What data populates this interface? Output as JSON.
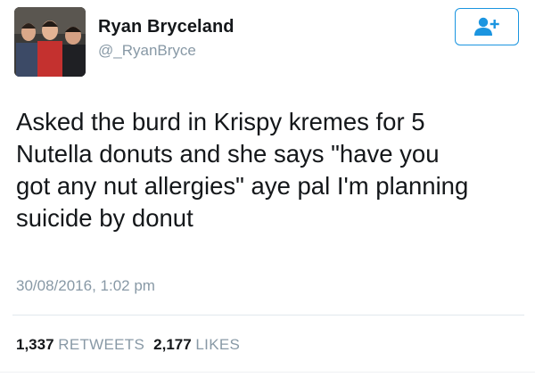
{
  "user": {
    "name": "Ryan Bryceland",
    "handle": "@_RyanBryce"
  },
  "tweet": {
    "lines": [
      "Asked the burd in Krispy kremes for 5",
      "Nutella donuts and she says \"have you",
      "got any nut allergies\" aye pal I'm planning",
      "suicide by donut"
    ],
    "timestamp": "30/08/2016, 1:02 pm"
  },
  "stats": {
    "retweets_count": "1,337",
    "retweets_label": "RETWEETS",
    "likes_count": "2,177",
    "likes_label": "LIKES"
  },
  "icons": {
    "follow": "add-user-icon"
  },
  "colors": {
    "accent": "#1b95e0",
    "text": "#14171a",
    "muted": "#8899a6",
    "divider": "#e1e8ed"
  }
}
